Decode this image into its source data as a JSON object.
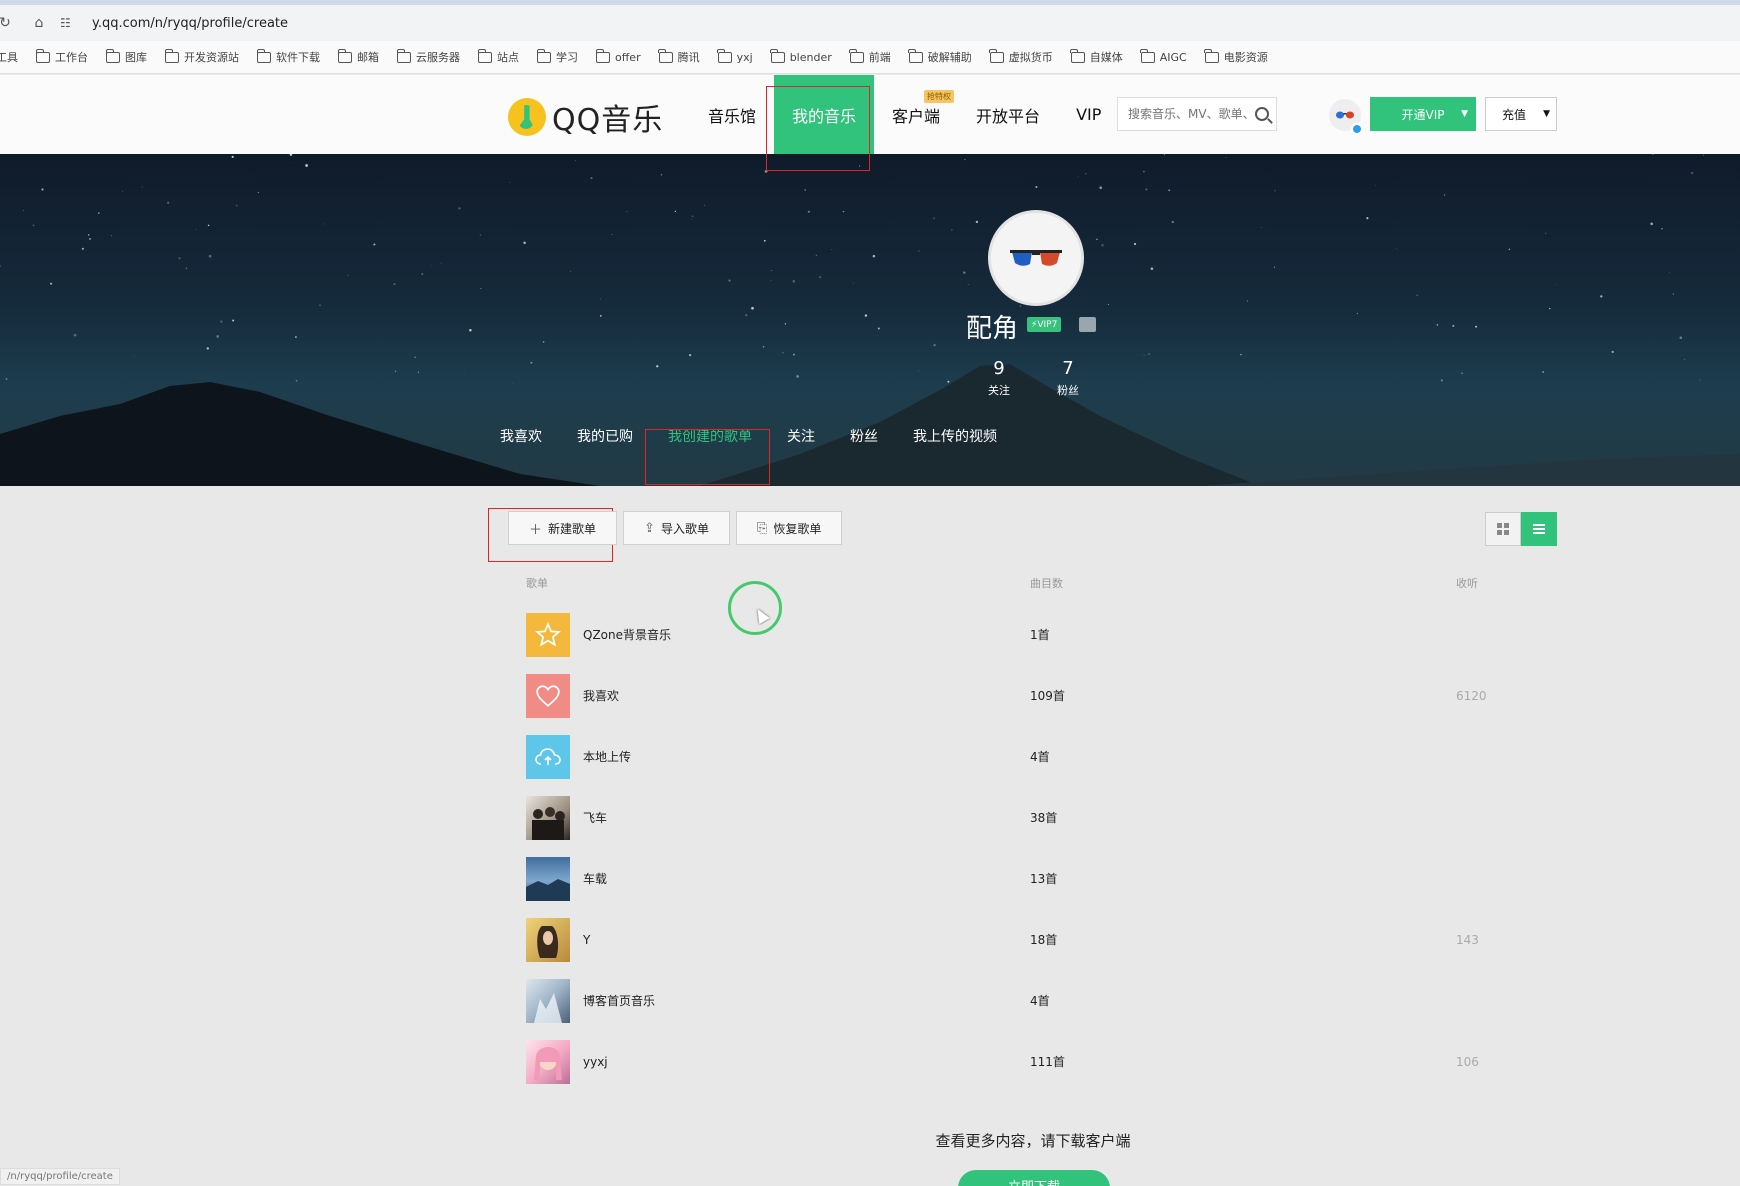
{
  "browser": {
    "url": "y.qq.com/n/ryqq/profile/create",
    "status_url": "/n/ryqq/profile/create",
    "bookmarks": [
      "工具",
      "工作台",
      "图库",
      "开发资源站",
      "软件下载",
      "邮箱",
      "云服务器",
      "站点",
      "学习",
      "offer",
      "腾讯",
      "yxj",
      "blender",
      "前端",
      "破解辅助",
      "虚拟货币",
      "自媒体",
      "AIGC",
      "电影资源"
    ]
  },
  "header": {
    "logo_text": "QQ音乐",
    "nav": [
      "音乐馆",
      "我的音乐",
      "客户端",
      "开放平台",
      "VIP"
    ],
    "active_nav": "我的音乐",
    "client_badge": "抢特权",
    "search_placeholder": "搜索音乐、MV、歌单、用户",
    "vip_button": "开通VIP",
    "recharge_button": "充值"
  },
  "profile": {
    "name": "配角",
    "vip_level": "VIP7",
    "following_count": "9",
    "following_label": "关注",
    "fans_count": "7",
    "fans_label": "粉丝",
    "tabs": [
      "我喜欢",
      "我的已购",
      "我创建的歌单",
      "关注",
      "粉丝",
      "我上传的视频"
    ],
    "active_tab": "我创建的歌单"
  },
  "toolbar": {
    "new_playlist": "新建歌单",
    "import_playlist": "导入歌单",
    "restore_playlist": "恢复歌单"
  },
  "table": {
    "col_playlist": "歌单",
    "col_count": "曲目数",
    "col_plays": "收听",
    "rows": [
      {
        "name": "QZone背景音乐",
        "count": "1首",
        "plays": ""
      },
      {
        "name": "我喜欢",
        "count": "109首",
        "plays": "6120"
      },
      {
        "name": "本地上传",
        "count": "4首",
        "plays": ""
      },
      {
        "name": "飞车",
        "count": "38首",
        "plays": ""
      },
      {
        "name": "车载",
        "count": "13首",
        "plays": ""
      },
      {
        "name": "Y",
        "count": "18首",
        "plays": "143"
      },
      {
        "name": "博客首页音乐",
        "count": "4首",
        "plays": ""
      },
      {
        "name": "yyxj",
        "count": "111首",
        "plays": "106"
      }
    ]
  },
  "footer": {
    "tip": "查看更多内容，请下载客户端",
    "download_button": "立即下载"
  },
  "colors": {
    "brand_green": "#31c27c",
    "highlight_red": "#e0242a"
  }
}
